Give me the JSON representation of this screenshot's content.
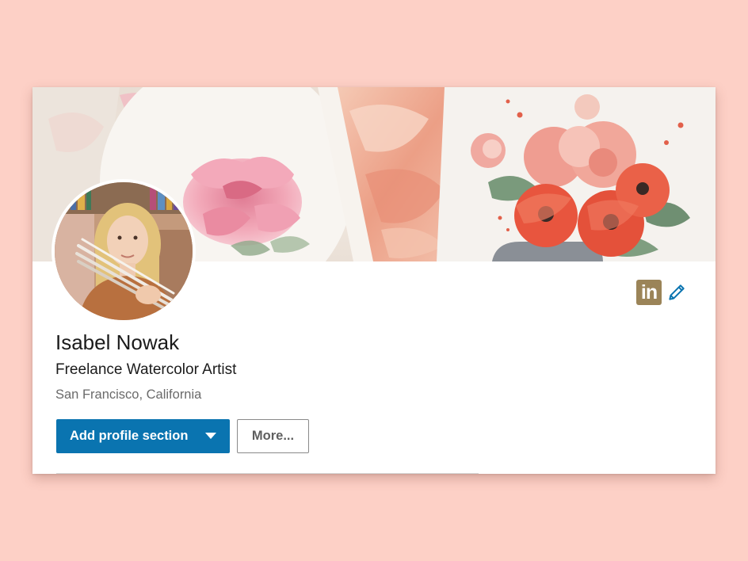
{
  "profile": {
    "name": "Isabel Nowak",
    "headline": "Freelance Watercolor Artist",
    "location": "San Francisco, California"
  },
  "actions": {
    "add_section_label": "Add profile section",
    "more_label": "More..."
  },
  "icons": {
    "linkedin": "linkedin-icon",
    "edit": "pencil-icon",
    "dropdown": "caret-down-icon"
  },
  "colors": {
    "page_background": "#fdd0c6",
    "primary_button": "#0a74b0",
    "linkedin_badge": "#9b8458",
    "edit_icon": "#0a74b0"
  }
}
